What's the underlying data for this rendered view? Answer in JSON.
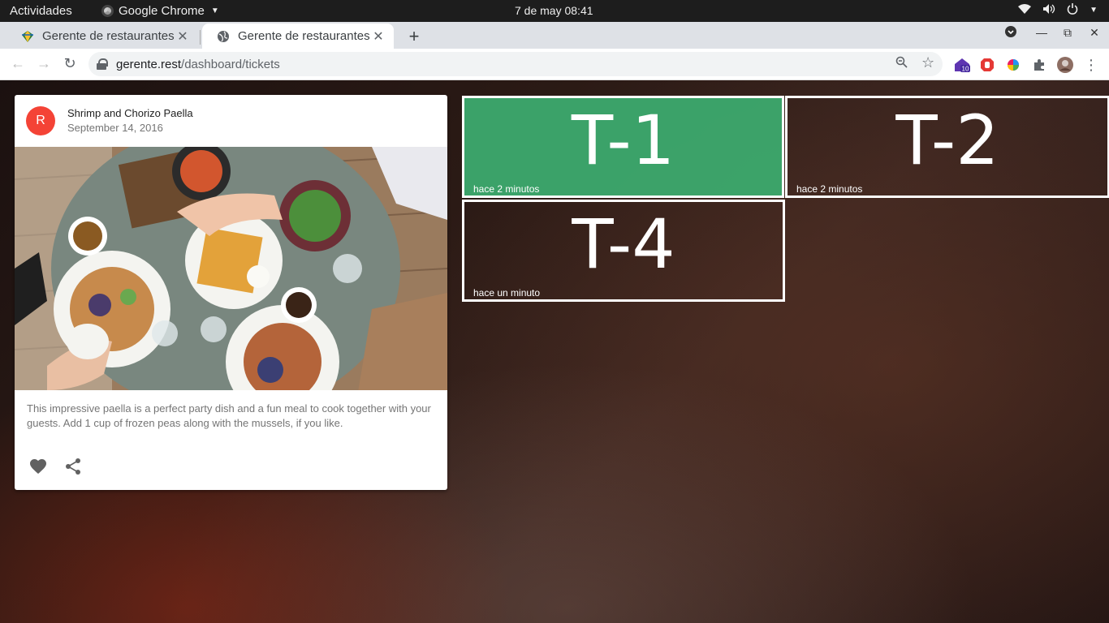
{
  "topbar": {
    "activities": "Actividades",
    "app_name": "Google Chrome",
    "clock": "7 de may  08:41"
  },
  "tabs": [
    {
      "title": "Gerente de restaurantes",
      "active": false
    },
    {
      "title": "Gerente de restaurantes",
      "active": true
    }
  ],
  "omnibox": {
    "host": "gerente.rest",
    "path": "/dashboard/tickets"
  },
  "extensions": {
    "badge_count": "10"
  },
  "card": {
    "avatar_letter": "R",
    "title": "Shrimp and Chorizo Paella",
    "subheader": "September 14, 2016",
    "description": "This impressive paella is a perfect party dish and a fun meal to cook together with your guests. Add 1 cup of frozen peas along with the mussels, if you like.",
    "avatar_color": "#f44336"
  },
  "tickets": [
    {
      "label": "T-1",
      "time": "hace 2 minutos",
      "status": "ready",
      "color": "#3caa6e"
    },
    {
      "label": "T-2",
      "time": "hace 2 minutos",
      "status": "pending"
    },
    {
      "label": "T-4",
      "time": "hace un minuto",
      "status": "pending"
    }
  ]
}
